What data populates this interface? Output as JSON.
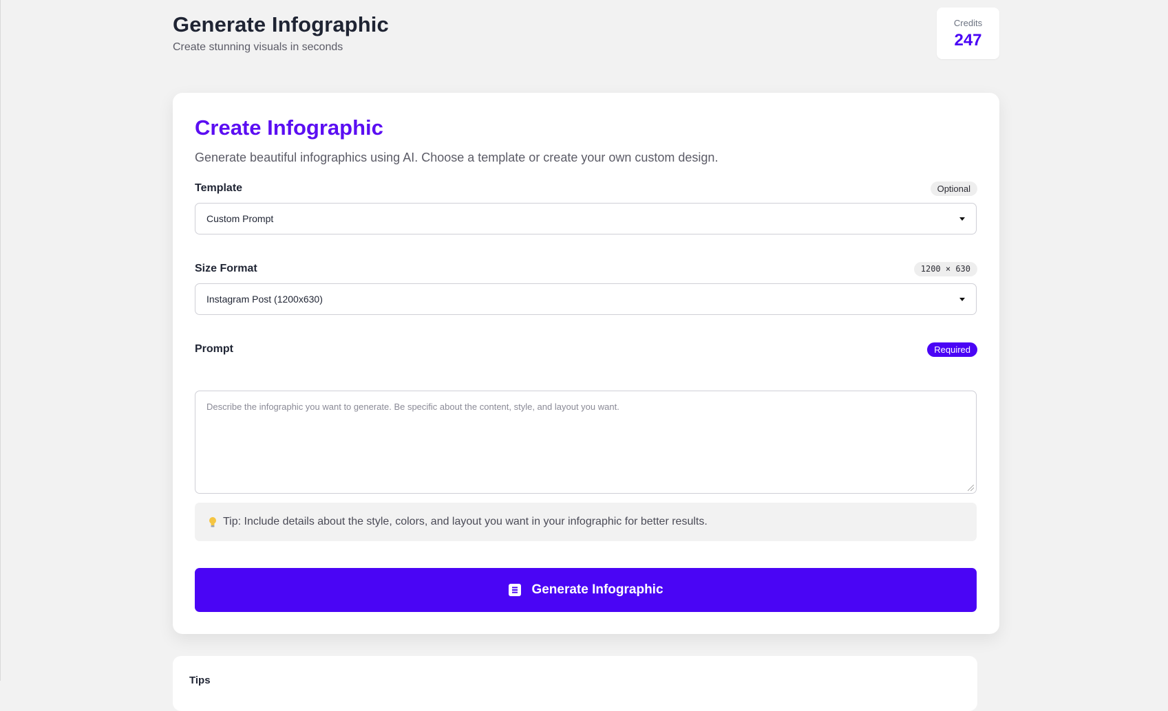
{
  "header": {
    "title": "Generate Infographic",
    "subtitle": "Create stunning visuals in seconds"
  },
  "credits": {
    "label": "Credits",
    "value": "247"
  },
  "form": {
    "title": "Create Infographic",
    "description": "Generate beautiful infographics using AI. Choose a template or create your own custom design.",
    "template": {
      "label": "Template",
      "badge": "Optional",
      "value": "Custom Prompt"
    },
    "size_format": {
      "label": "Size Format",
      "badge": "1200 × 630",
      "value": "Instagram Post (1200x630)"
    },
    "prompt": {
      "label": "Prompt",
      "badge": "Required",
      "placeholder": "Describe the infographic you want to generate. Be specific about the content, style, and layout you want.",
      "value": ""
    },
    "tip": {
      "icon": "lightbulb-icon",
      "text": "Tip: Include details about the style, colors, and layout you want in your infographic for better results."
    },
    "generate_button": {
      "icon": "document-icon",
      "label": "Generate Infographic"
    }
  },
  "tips_section": {
    "title": "Tips"
  },
  "colors": {
    "accent": "#4a05f5",
    "title_purple": "#5b0ef2",
    "background": "#f2f2f2"
  }
}
